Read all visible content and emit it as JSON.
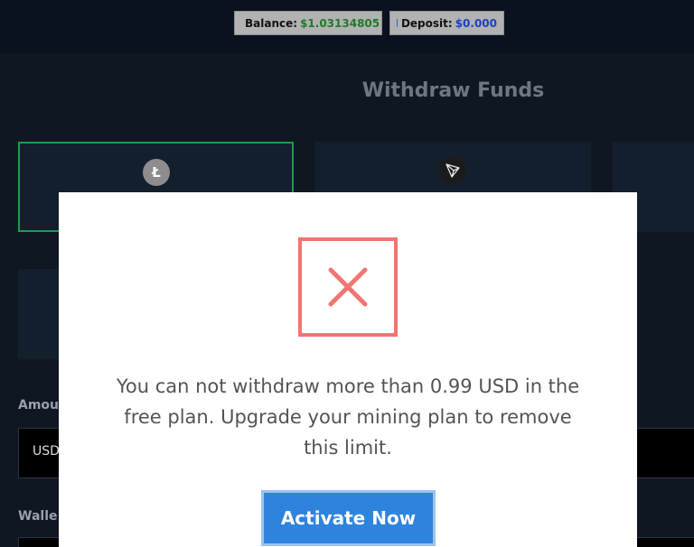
{
  "header": {
    "balance": {
      "label": "Balance:",
      "value": "$1.03134805",
      "icon": "wallet-icon",
      "color": "#1f7a2b"
    },
    "deposit": {
      "label": "Deposit:",
      "value": "$0.000",
      "icon": "card-icon",
      "color": "#1d3fc2"
    }
  },
  "page": {
    "title": "Withdraw Funds",
    "coins": [
      {
        "icon": "litecoin-icon",
        "glyph": "Ł",
        "selected": true
      },
      {
        "icon": "tron-icon",
        "selected": false
      }
    ],
    "amount_label": "Amou",
    "amount_unit": "USD",
    "wallet_label": "Walle"
  },
  "modal": {
    "icon": "error-x-icon",
    "message": "You can not withdraw more than 0.99 USD in the free plan. Upgrade your mining plan to remove this limit.",
    "button_label": "Activate Now",
    "colors": {
      "accent": "#2e84dc",
      "error": "#f27474"
    }
  }
}
